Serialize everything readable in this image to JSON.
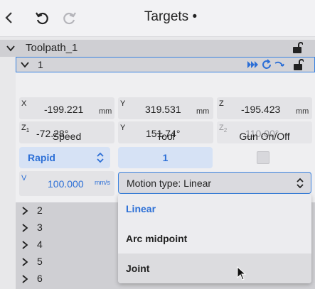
{
  "header": {
    "title": "Targets •"
  },
  "tree": {
    "toolpath_label": "Toolpath_1",
    "item1_label": "1",
    "collapsed_items": [
      "2",
      "3",
      "4",
      "5",
      "6"
    ]
  },
  "target": {
    "x": {
      "tag": "X",
      "value": "-199.221",
      "unit": "mm"
    },
    "y": {
      "tag": "Y",
      "value": "319.531",
      "unit": "mm"
    },
    "z": {
      "tag": "Z",
      "value": "-195.423",
      "unit": "mm"
    },
    "z1": {
      "tag": "Z",
      "tag_sub": "1",
      "value": "-72.28°"
    },
    "y2": {
      "tag": "Y",
      "value": "151.74°"
    },
    "z2": {
      "tag": "Z",
      "tag_sub": "2",
      "value": "110.00°"
    }
  },
  "columns": {
    "speed": "Speed",
    "tool": "Tool",
    "gun": "Gun On/Off"
  },
  "speed": {
    "value": "Rapid"
  },
  "tool": {
    "value": "1"
  },
  "gun": {
    "checked": false
  },
  "velocity": {
    "tag": "V",
    "value": "100.000",
    "unit": "mm/s"
  },
  "motion": {
    "label": "Motion type: Linear",
    "options": [
      "Linear",
      "Arc midpoint",
      "Joint"
    ],
    "selected": "Linear",
    "hovered": "Joint"
  },
  "colors": {
    "accent": "#2c6fd6",
    "border_focus": "#3b83e0"
  }
}
